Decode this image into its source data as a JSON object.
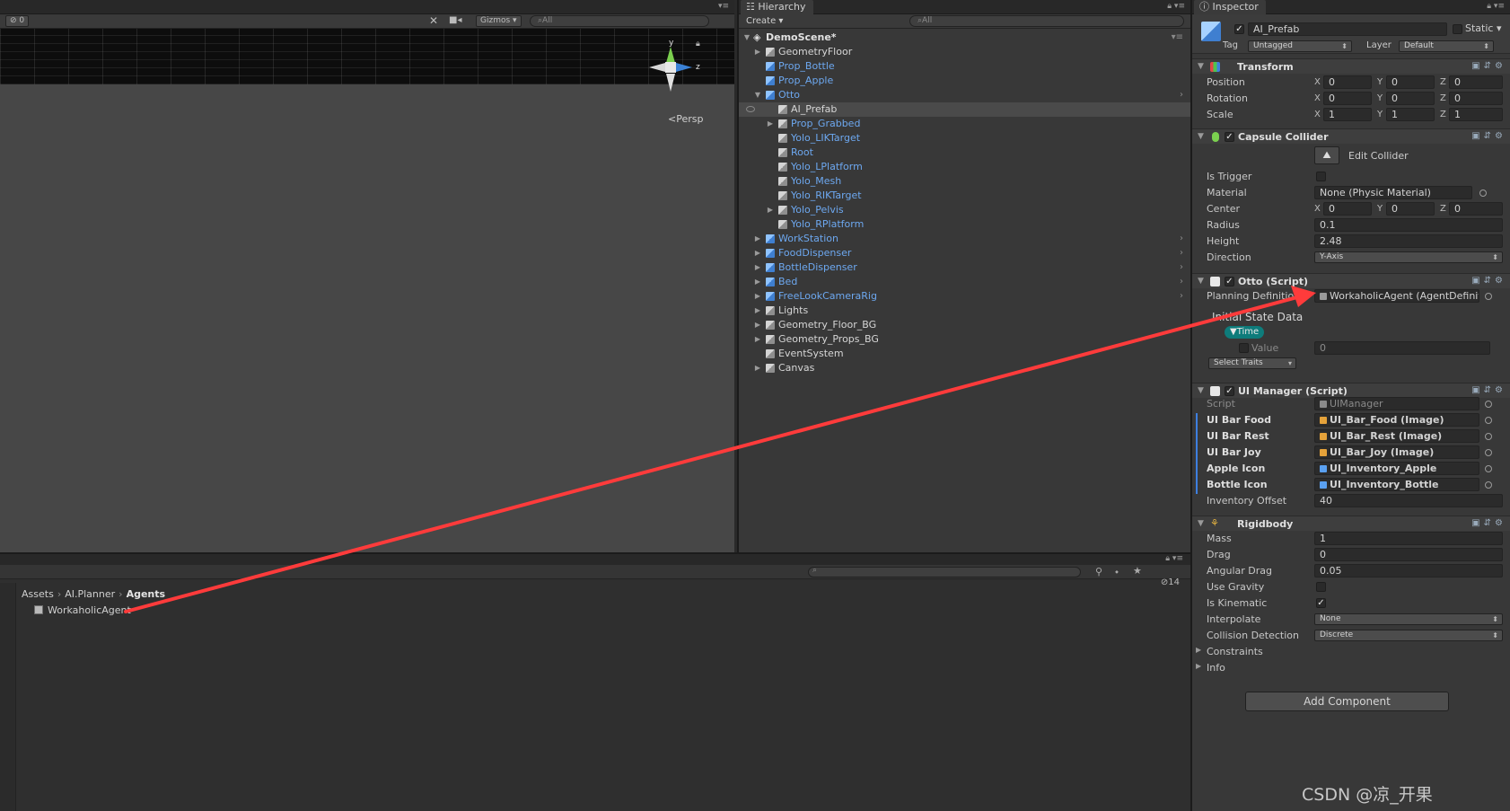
{
  "scene": {
    "hidden_count": "0",
    "gizmos_label": "Gizmos",
    "search_placeholder": "All",
    "persp_label": "Persp",
    "axis_y": "y",
    "axis_z": "z"
  },
  "hierarchy": {
    "tab_label": "Hierarchy",
    "create_label": "Create",
    "search_placeholder": "All",
    "scene_name": "DemoScene*",
    "items": [
      {
        "label": "GeometryFloor"
      },
      {
        "label": "Prop_Bottle"
      },
      {
        "label": "Prop_Apple"
      },
      {
        "label": "Otto"
      },
      {
        "label": "AI_Prefab"
      },
      {
        "label": "Prop_Grabbed"
      },
      {
        "label": "Yolo_LIKTarget"
      },
      {
        "label": "Root"
      },
      {
        "label": "Yolo_LPlatform"
      },
      {
        "label": "Yolo_Mesh"
      },
      {
        "label": "Yolo_RIKTarget"
      },
      {
        "label": "Yolo_Pelvis"
      },
      {
        "label": "Yolo_RPlatform"
      },
      {
        "label": "WorkStation"
      },
      {
        "label": "FoodDispenser"
      },
      {
        "label": "BottleDispenser"
      },
      {
        "label": "Bed"
      },
      {
        "label": "FreeLookCameraRig"
      },
      {
        "label": "Lights"
      },
      {
        "label": "Geometry_Floor_BG"
      },
      {
        "label": "Geometry_Props_BG"
      },
      {
        "label": "EventSystem"
      },
      {
        "label": "Canvas"
      }
    ]
  },
  "project": {
    "breadcrumb": [
      "Assets",
      "AI.Planner",
      "Agents"
    ],
    "asset_name": "WorkaholicAgent",
    "hidden_count": "14"
  },
  "inspector": {
    "tab_label": "Inspector",
    "object_name": "AI_Prefab",
    "static_label": "Static",
    "tag_label": "Tag",
    "tag_value": "Untagged",
    "layer_label": "Layer",
    "layer_value": "Default",
    "transform": {
      "title": "Transform",
      "position_label": "Position",
      "rotation_label": "Rotation",
      "scale_label": "Scale",
      "position": [
        "0",
        "0",
        "0"
      ],
      "rotation": [
        "0",
        "0",
        "0"
      ],
      "scale": [
        "1",
        "1",
        "1"
      ]
    },
    "capsule": {
      "title": "Capsule Collider",
      "edit_collider": "Edit Collider",
      "is_trigger_label": "Is Trigger",
      "material_label": "Material",
      "material_value": "None (Physic Material)",
      "center_label": "Center",
      "center": [
        "0",
        "0",
        "0"
      ],
      "radius_label": "Radius",
      "radius_value": "0.1",
      "height_label": "Height",
      "height_value": "2.48",
      "direction_label": "Direction",
      "direction_value": "Y-Axis"
    },
    "otto": {
      "title": "Otto (Script)",
      "planning_label": "Planning Definitio",
      "planning_value": "WorkaholicAgent (AgentDefinit",
      "initial_state_label": "Initial State Data",
      "time_chip": "Time",
      "value_label": "Value",
      "value_value": "0",
      "select_traits": "Select Traits"
    },
    "uimanager": {
      "title": "UI Manager (Script)",
      "script_label": "Script",
      "script_value": "UIManager",
      "rows": [
        {
          "label": "UI Bar Food",
          "value": "UI_Bar_Food (Image)"
        },
        {
          "label": "UI Bar Rest",
          "value": "UI_Bar_Rest (Image)"
        },
        {
          "label": "UI Bar Joy",
          "value": "UI_Bar_Joy (Image)"
        },
        {
          "label": "Apple Icon",
          "value": "UI_Inventory_Apple"
        },
        {
          "label": "Bottle Icon",
          "value": "UI_Inventory_Bottle"
        }
      ],
      "offset_label": "Inventory Offset",
      "offset_value": "40"
    },
    "rigidbody": {
      "title": "Rigidbody",
      "mass_label": "Mass",
      "mass_value": "1",
      "drag_label": "Drag",
      "drag_value": "0",
      "angular_label": "Angular Drag",
      "angular_value": "0.05",
      "gravity_label": "Use Gravity",
      "kinematic_label": "Is Kinematic",
      "interpolate_label": "Interpolate",
      "interpolate_value": "None",
      "collision_label": "Collision Detection",
      "collision_value": "Discrete",
      "constraints_label": "Constraints",
      "info_label": "Info"
    },
    "add_component": "Add Component"
  },
  "xyz_labels": [
    "X",
    "Y",
    "Z"
  ],
  "watermark": "CSDN @凉_开果",
  "colors": {
    "annotation_arrow": "#ff3b3b",
    "hierarchy_prefab_text": "#6da8f0",
    "selection": "#4a4a4a"
  }
}
